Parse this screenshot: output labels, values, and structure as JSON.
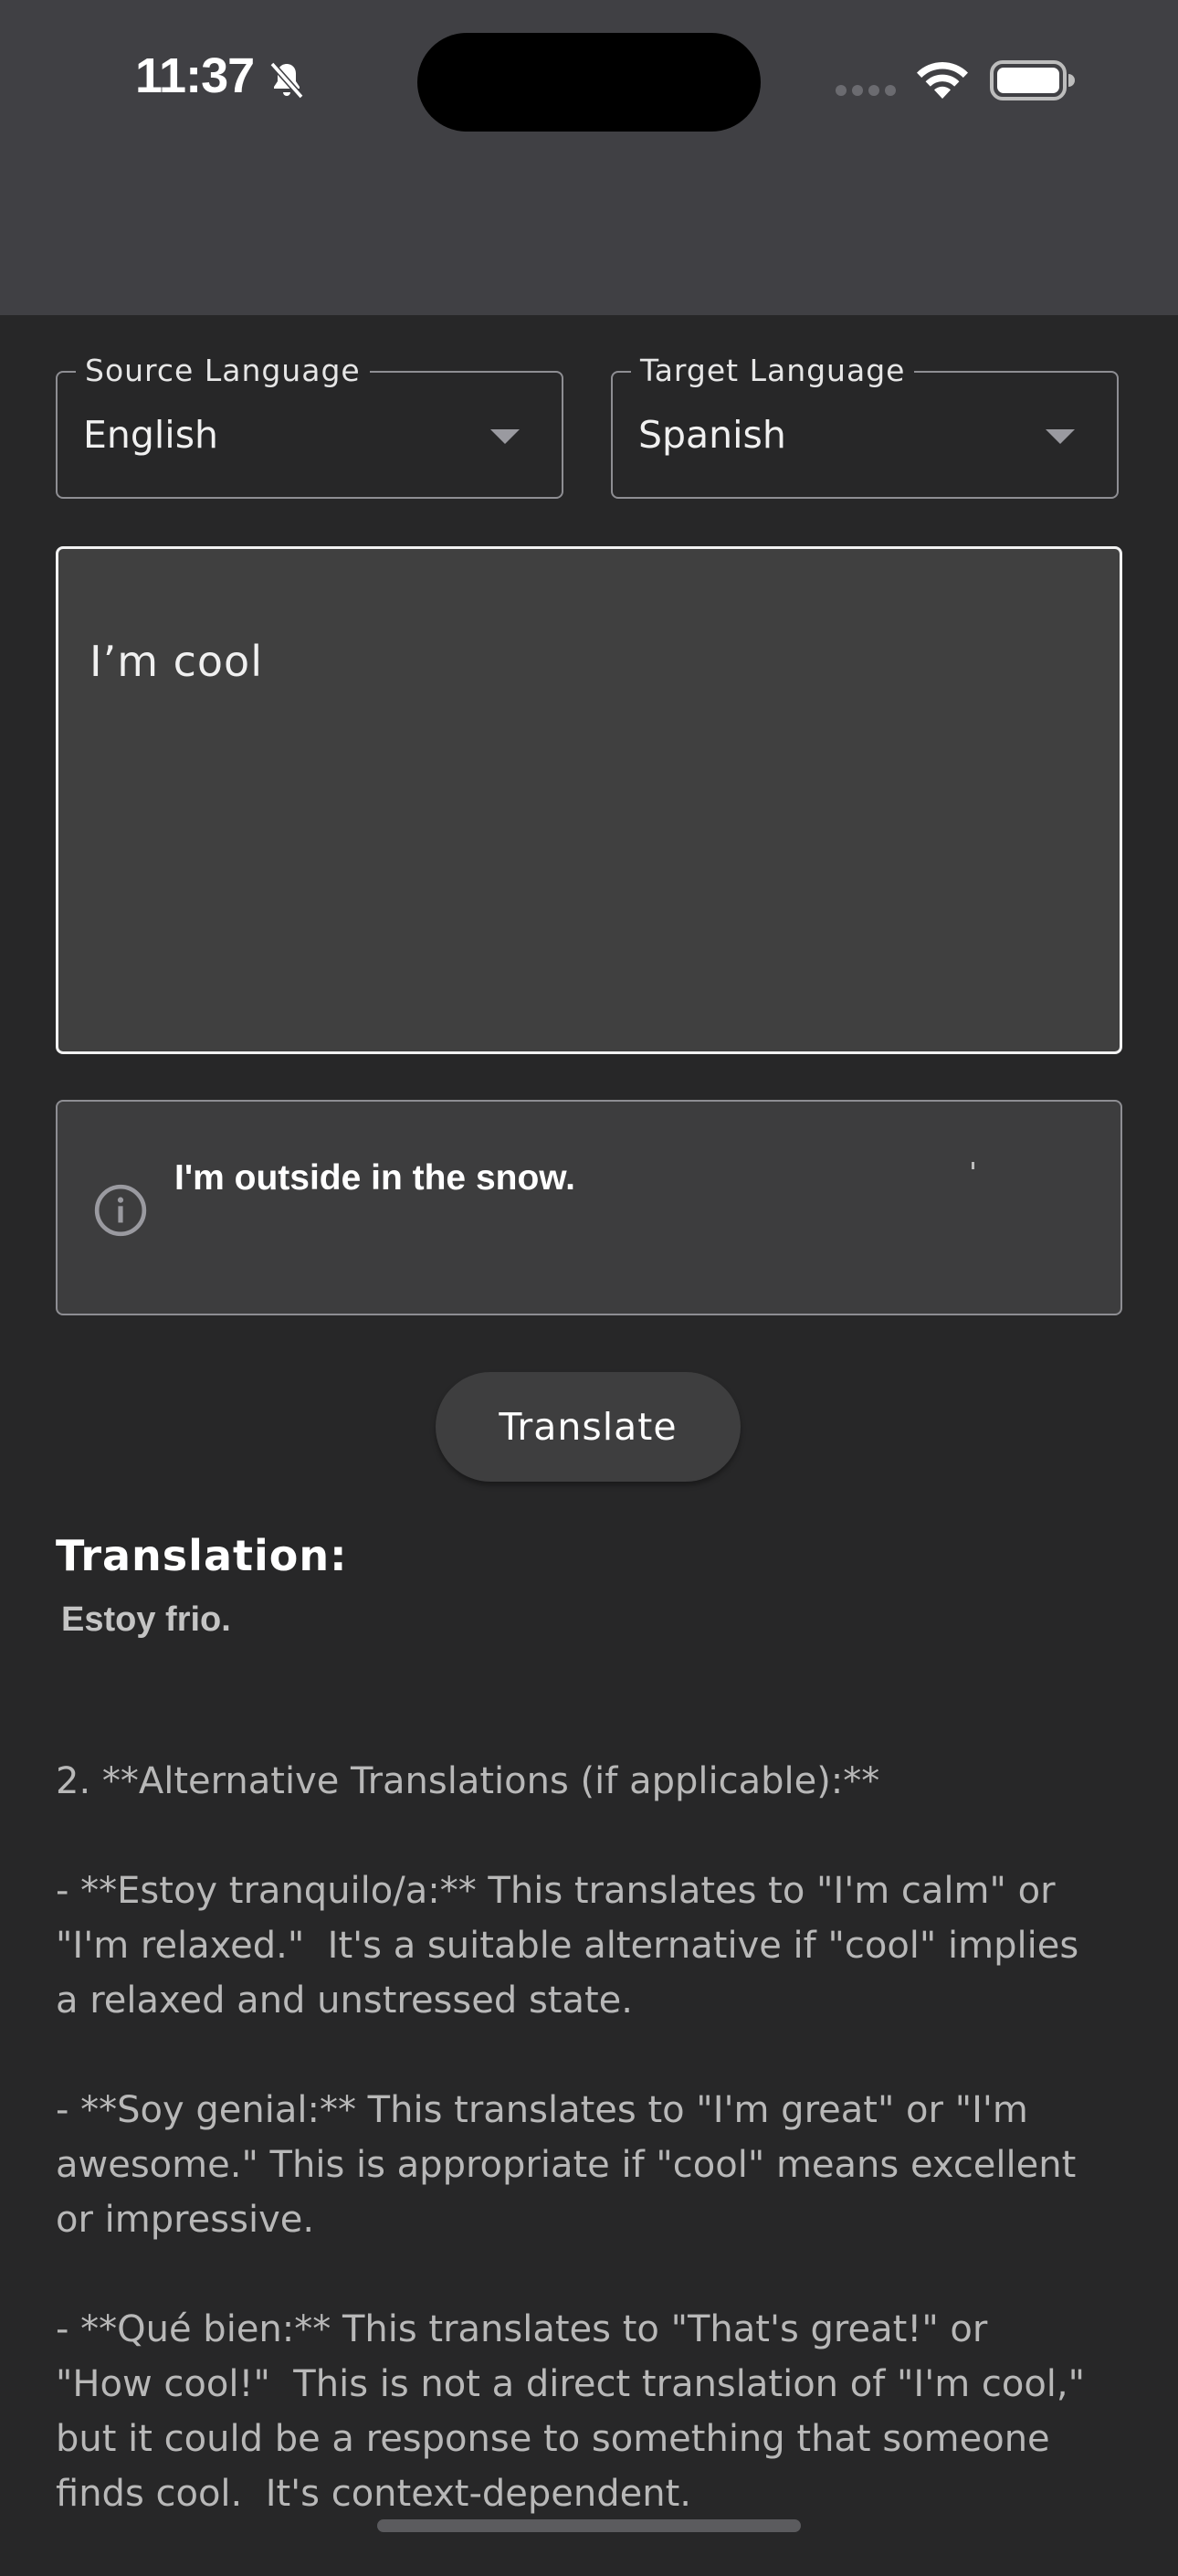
{
  "status_bar": {
    "time": "11:37",
    "icons": [
      "bell-slash-icon",
      "signal-dots-icon",
      "wifi-icon",
      "battery-icon"
    ]
  },
  "source_language": {
    "label": "Source Language",
    "value": "English"
  },
  "target_language": {
    "label": "Target Language",
    "value": "Spanish"
  },
  "input": {
    "value": "I’m cool"
  },
  "info_card": {
    "icon": "info-icon",
    "text": "I'm outside in the snow."
  },
  "translate_button": {
    "label": "Translate"
  },
  "translation": {
    "heading": "Translation:",
    "main": "Estoy frio.",
    "paragraphs": [
      "2. **Alternative Translations (if applicable):**",
      "- **Estoy tranquilo/a:** This translates to \"I'm calm\" or\n\"I'm relaxed.\"  It's a suitable alternative if \"cool\" implies\na relaxed and unstressed state.",
      "- **Soy genial:** This translates to \"I'm great\" or \"I'm\nawesome.\" This is appropriate if \"cool\" means excellent\nor impressive.",
      "- **Qué bien:** This translates to \"That's great!\" or\n\"How cool!\"  This is not a direct translation of \"I'm cool,\"\nbut it could be a response to something that someone\nfinds cool.  It's context-dependent."
    ]
  },
  "colors": {
    "background": "#272728",
    "app_bar": "#404044",
    "outline": "#8e8e93",
    "input_fill": "#404040"
  }
}
